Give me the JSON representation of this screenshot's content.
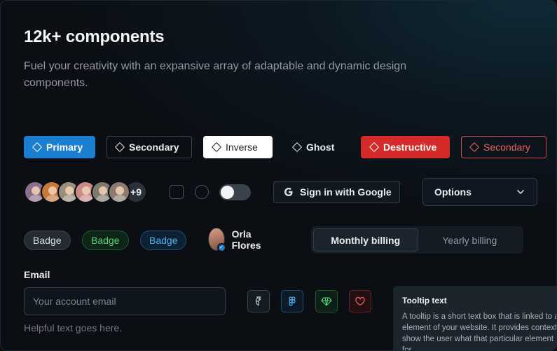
{
  "header": {
    "title": "12k+ components",
    "subtitle": "Fuel your creativity with an expansive array of adaptable and dynamic design components."
  },
  "buttons": {
    "primary": "Primary",
    "secondary": "Secondary",
    "inverse": "Inverse",
    "ghost": "Ghost",
    "destructive": "Destructive",
    "destructive_secondary": "Secondary"
  },
  "avatars": {
    "more_count": "+9"
  },
  "google_button": "Sign in with Google",
  "select": {
    "value": "Options"
  },
  "badges": [
    {
      "label": "Badge",
      "color": "#d9dee4"
    },
    {
      "label": "Badge",
      "color": "#52d27c"
    },
    {
      "label": "Badge",
      "color": "#4fb0f0"
    }
  ],
  "user": {
    "name": "Orla Flores"
  },
  "billing": {
    "options": [
      "Monthly billing",
      "Yearly billing"
    ],
    "selected": "Monthly billing"
  },
  "email": {
    "label": "Email",
    "placeholder": "Your account email",
    "value": "",
    "helper": "Helpful text goes here."
  },
  "icon_buttons": [
    "figma-outline-icon",
    "figma-icon",
    "gem-icon",
    "heart-icon"
  ],
  "tooltip": {
    "title": "Tooltip text",
    "body": "A tooltip is a short text box that is linked to an element of your website. It provides context to show the user what that particular element is for."
  },
  "colors": {
    "accent": "#1a7fd0",
    "destructive": "#d42a2a",
    "success": "#52d27c"
  }
}
